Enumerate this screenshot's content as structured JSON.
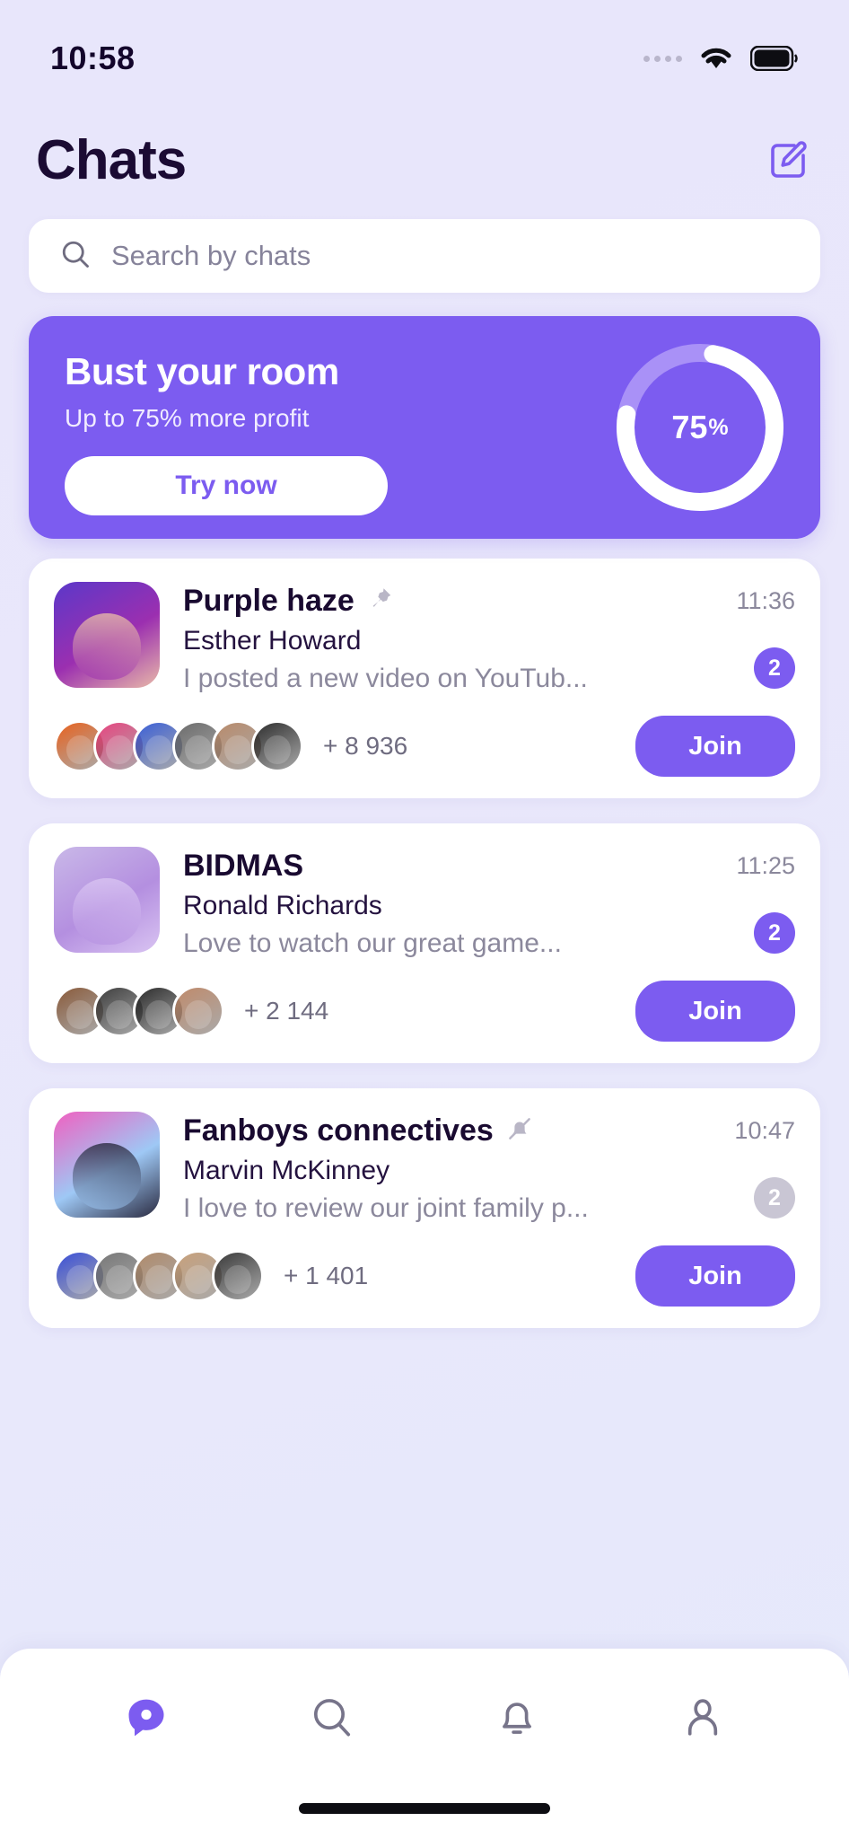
{
  "status_bar": {
    "time": "10:58",
    "signal_icon": "signal-dots-icon",
    "wifi_icon": "wifi-icon",
    "battery_icon": "battery-icon"
  },
  "header": {
    "title": "Chats",
    "compose_icon": "compose-edit-icon"
  },
  "search": {
    "placeholder": "Search by chats",
    "value": "",
    "icon": "search-icon"
  },
  "banner": {
    "title": "Bust your room",
    "subtitle": "Up to 75% more profit",
    "button_label": "Try now",
    "progress_value": 75,
    "progress_label": "75",
    "progress_suffix": "%",
    "accent_color": "#7c5cf0",
    "track_color": "#a991f7",
    "arc_color": "#ffffff"
  },
  "chats": [
    {
      "title": "Purple haze",
      "status_icon": "pin-icon",
      "sender": "Esther Howard",
      "preview": "I posted a new video on YouTub...",
      "time": "11:36",
      "unread": "2",
      "unread_color": "#7c5cf0",
      "members_more": "+ 8 936",
      "join_label": "Join",
      "join_color": "#7c5cf0",
      "avatar_colors": [
        "#5b38c9",
        "#9b2fb0",
        "#e8b9a8"
      ],
      "member_colors": [
        "#e8621e",
        "#e8437f",
        "#3a5fd8",
        "#6b6b6b",
        "#b98a6a",
        "#2e2e2e"
      ]
    },
    {
      "title": "BIDMAS",
      "status_icon": "",
      "sender": "Ronald Richards",
      "preview": "Love to watch our great game...",
      "time": "11:25",
      "unread": "2",
      "unread_color": "#7c5cf0",
      "members_more": "+ 2 144",
      "join_label": "Join",
      "join_color": "#7c5cf0",
      "avatar_colors": [
        "#c9b8e8",
        "#b48fe0",
        "#d9c4f2"
      ],
      "member_colors": [
        "#8a5a3a",
        "#3d3d3d",
        "#2b2b2b",
        "#c08a6a"
      ]
    },
    {
      "title": "Fanboys connectives",
      "status_icon": "bell-muted-icon",
      "sender": "Marvin McKinney",
      "preview": "I love to review our joint family p...",
      "time": "10:47",
      "unread": "2",
      "unread_color": "#c9c6d4",
      "members_more": "+ 1 401",
      "join_label": "Join",
      "join_color": "#7c5cf0",
      "avatar_colors": [
        "#f060c0",
        "#9ec8f5",
        "#2a2a40"
      ],
      "member_colors": [
        "#3a4fd8",
        "#777777",
        "#b08a6a",
        "#c8a07a",
        "#3a3a3a"
      ]
    }
  ],
  "tabbar": {
    "items": [
      {
        "icon": "chat-bubble-icon",
        "active": true
      },
      {
        "icon": "search-icon",
        "active": false
      },
      {
        "icon": "bell-icon",
        "active": false
      },
      {
        "icon": "person-icon",
        "active": false
      }
    ],
    "active_color": "#7c5cf0",
    "inactive_color": "#77748a"
  }
}
